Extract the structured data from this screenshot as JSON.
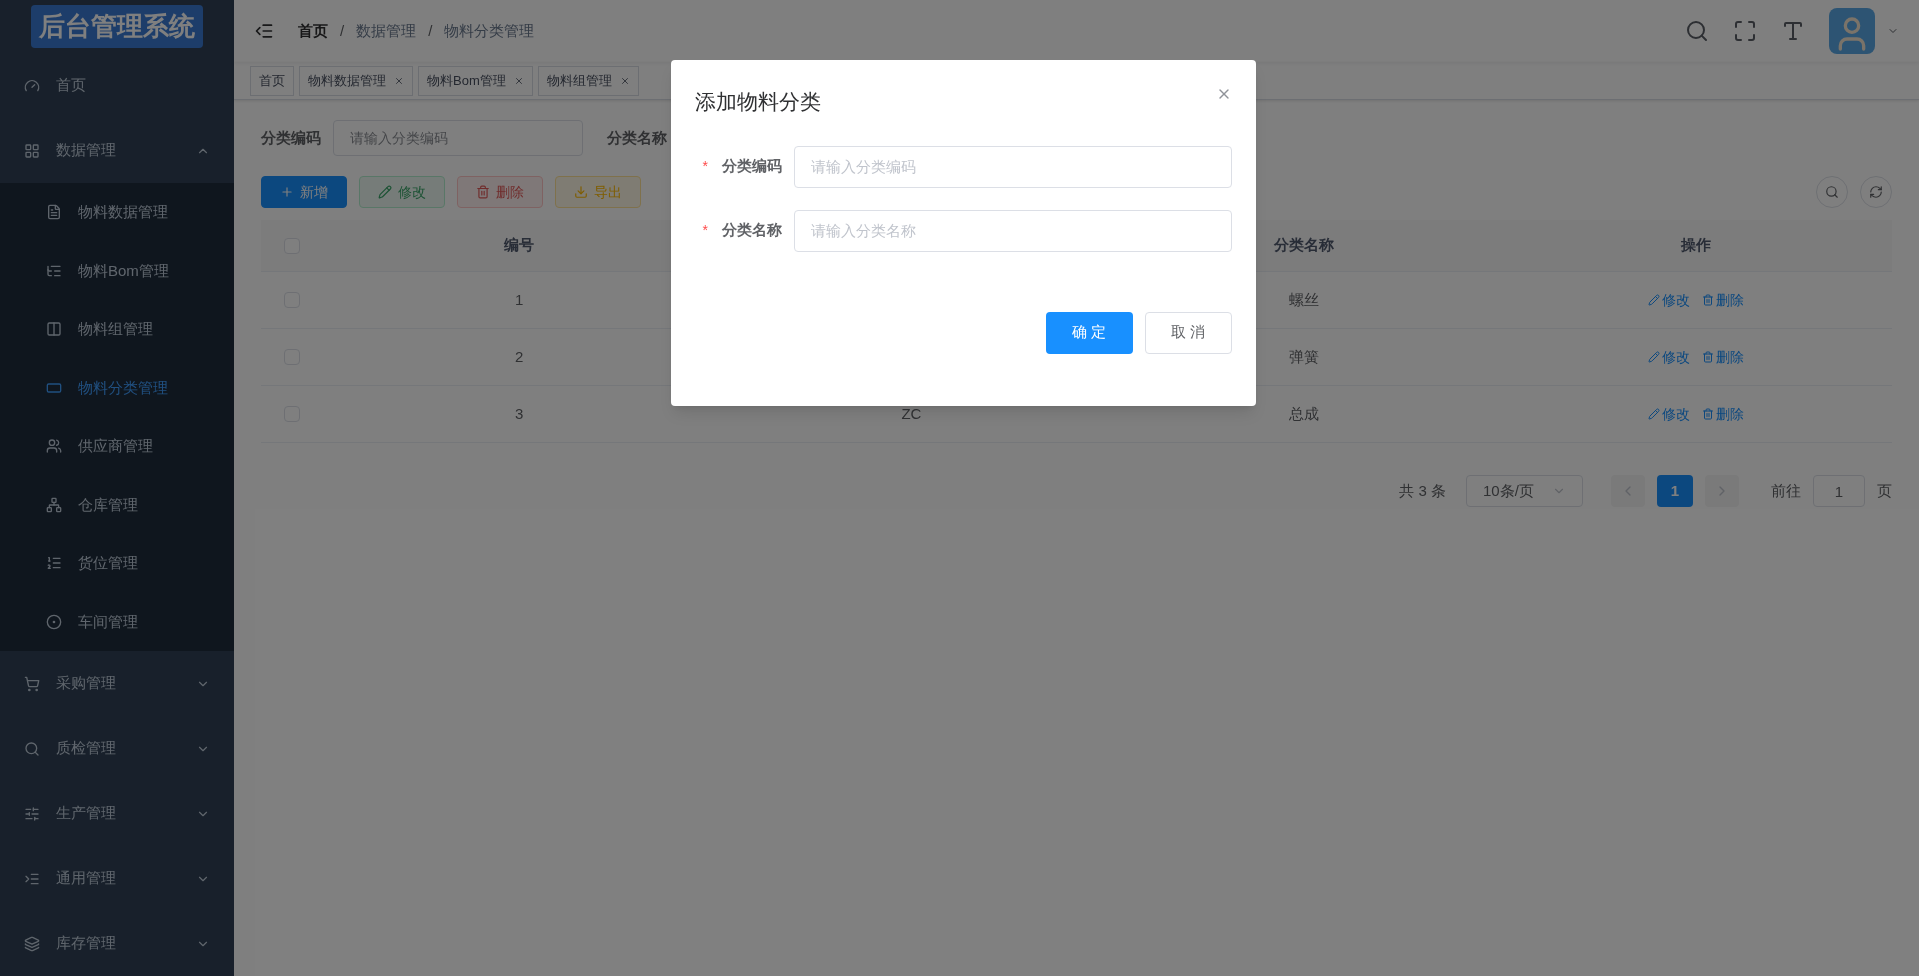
{
  "logo": {
    "text": "后台管理系统"
  },
  "sidebar": {
    "items": [
      {
        "label": "首页",
        "kind": "link",
        "selected": false
      },
      {
        "label": "数据管理",
        "kind": "group",
        "expanded": true,
        "children": [
          {
            "label": "物料数据管理",
            "selected": false
          },
          {
            "label": "物料Bom管理",
            "selected": false
          },
          {
            "label": "物料组管理",
            "selected": false
          },
          {
            "label": "物料分类管理",
            "selected": true
          },
          {
            "label": "供应商管理",
            "selected": false
          },
          {
            "label": "仓库管理",
            "selected": false
          },
          {
            "label": "货位管理",
            "selected": false
          },
          {
            "label": "车间管理",
            "selected": false
          }
        ]
      },
      {
        "label": "采购管理",
        "kind": "group",
        "expanded": false
      },
      {
        "label": "质检管理",
        "kind": "group",
        "expanded": false
      },
      {
        "label": "生产管理",
        "kind": "group",
        "expanded": false
      },
      {
        "label": "通用管理",
        "kind": "group",
        "expanded": false
      },
      {
        "label": "库存管理",
        "kind": "group",
        "expanded": false
      }
    ]
  },
  "breadcrumb": {
    "separator": "/",
    "items": [
      "首页",
      "数据管理",
      "物料分类管理"
    ]
  },
  "tags": [
    {
      "label": "首页",
      "closable": false,
      "selected": false
    },
    {
      "label": "物料数据管理",
      "closable": true,
      "selected": false
    },
    {
      "label": "物料Bom管理",
      "closable": true,
      "selected": false
    },
    {
      "label": "物料组管理",
      "closable": true,
      "selected": false
    }
  ],
  "filters": [
    {
      "label": "分类编码",
      "placeholder": "请输入分类编码"
    },
    {
      "label": "分类名称"
    }
  ],
  "toolbar": [
    {
      "label": "新增",
      "kind": "primary",
      "disabled": false
    },
    {
      "label": "修改",
      "kind": "success",
      "disabled": true
    },
    {
      "label": "删除",
      "kind": "danger",
      "disabled": true
    },
    {
      "label": "导出",
      "kind": "warning",
      "disabled": false
    }
  ],
  "table": {
    "all_checked": false,
    "columns": {
      "number": "编号",
      "name": "分类名称",
      "actions": "操作"
    },
    "rows": [
      {
        "checked": false,
        "number": "1",
        "name": "螺丝",
        "actions": [
          "修改",
          "删除"
        ]
      },
      {
        "checked": false,
        "number": "2",
        "name": "弹簧",
        "actions": [
          "修改",
          "删除"
        ]
      },
      {
        "checked": false,
        "number": "3",
        "column_3": "ZC",
        "name": "总成",
        "actions": [
          "修改",
          "删除"
        ]
      }
    ]
  },
  "pagination": {
    "total": "共 3 条",
    "page_size": "10条/页",
    "pages": [
      {
        "label": "1",
        "selected": true
      }
    ],
    "goto_label": "前往",
    "goto_value": "1",
    "page_suffix": "页"
  },
  "dialog": {
    "title": "添加物料分类",
    "required_mark": "*",
    "fields": [
      {
        "label": "分类编码",
        "placeholder": "请输入分类编码",
        "required": true
      },
      {
        "label": "分类名称",
        "placeholder": "请输入分类名称",
        "required": true
      }
    ],
    "confirm": "确 定",
    "cancel": "取 消"
  }
}
